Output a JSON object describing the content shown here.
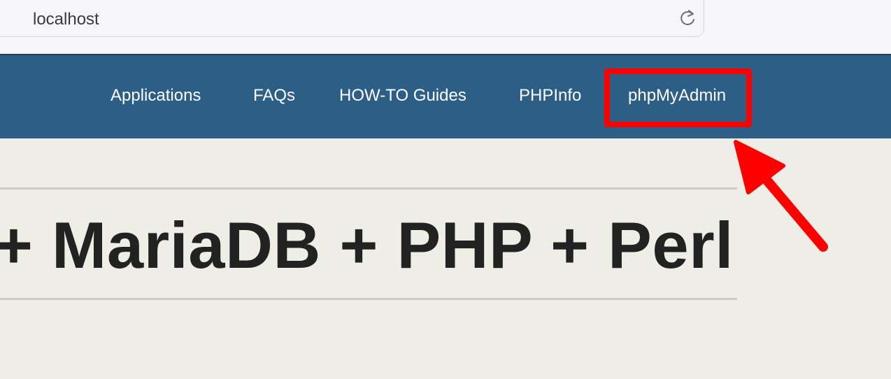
{
  "browser": {
    "url": "localhost",
    "reload_icon": "reload-icon"
  },
  "nav": {
    "links": [
      {
        "label": "Applications"
      },
      {
        "label": "FAQs"
      },
      {
        "label": "HOW-TO Guides"
      },
      {
        "label": "PHPInfo"
      },
      {
        "label": "phpMyAdmin"
      }
    ]
  },
  "main": {
    "headline": "+ MariaDB + PHP + Perl"
  },
  "annotation": {
    "highlight_color": "#ff0000",
    "arrow_icon": "arrow-icon"
  },
  "colors": {
    "navbar": "#2d5e86",
    "page_background": "#efeee6",
    "headline_text": "#222222"
  }
}
